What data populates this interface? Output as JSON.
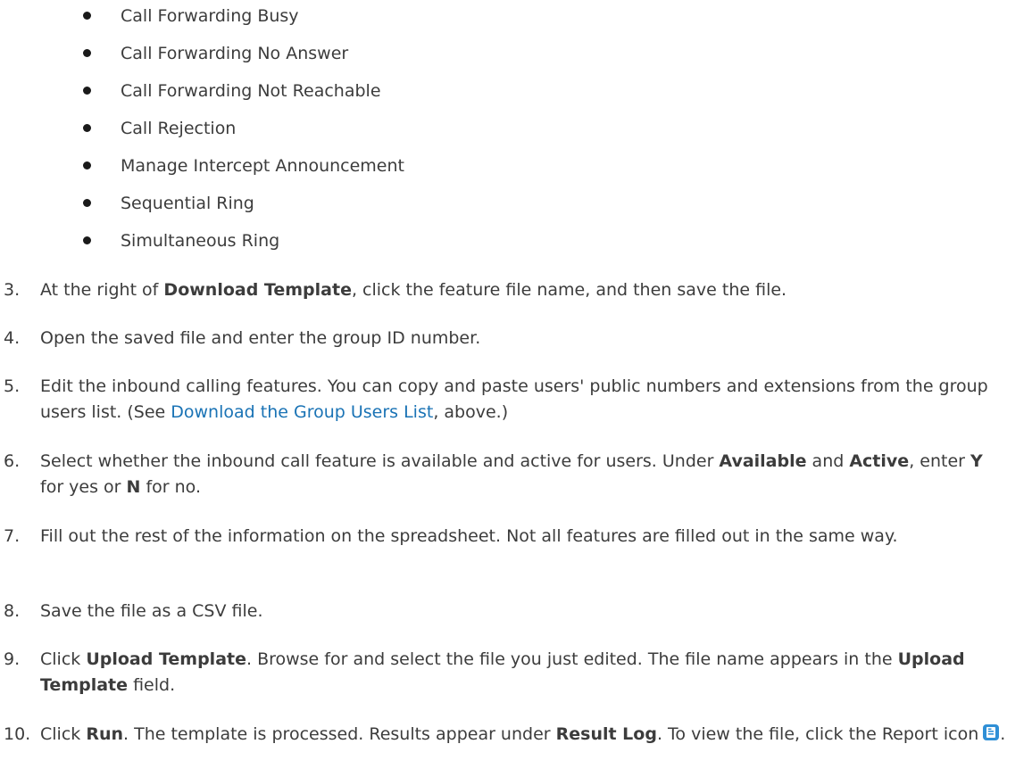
{
  "bullets": [
    "Call Forwarding Busy",
    "Call Forwarding No Answer",
    "Call Forwarding Not Reachable",
    "Call Rejection",
    "Manage Intercept Announcement",
    "Sequential Ring",
    "Simultaneous Ring"
  ],
  "steps": [
    {
      "num": "3.",
      "t1": "At the right of ",
      "b1": "Download Template",
      "t2": ", click the feature file name, and then save the file."
    },
    {
      "num": "4.",
      "t1": "Open the saved file and enter the group ID number."
    },
    {
      "num": "5.",
      "t1": "Edit the inbound calling features. You can copy and paste users' public numbers and extensions from the group users list. (See ",
      "link": "Download the Group Users List",
      "t2": ", above.)"
    },
    {
      "num": "6.",
      "t1": "Select whether the inbound call feature is available and active for users. Under ",
      "b1": "Available",
      "t2": " and ",
      "b2": "Active",
      "t3": ", enter ",
      "b3": "Y",
      "t4": " for yes or ",
      "b4": "N",
      "t5": " for no."
    },
    {
      "num": "7.",
      "t1": "Fill out the rest of the information on the spreadsheet. Not all features are filled out in the same way."
    },
    {
      "num": "8.",
      "t1": "Save the file as a CSV file."
    },
    {
      "num": "9.",
      "t1": "Click ",
      "b1": "Upload Template",
      "t2": ". Browse for and select the file you just edited. The file name appears in the ",
      "b2": "Upload Template",
      "t3": " field."
    },
    {
      "num": "10.",
      "t1": "Click ",
      "b1": "Run",
      "t2": ". The template is processed. Results appear under ",
      "b2": "Result Log",
      "t3": ". To view the file, click the Report icon",
      "t4": "."
    }
  ],
  "colors": {
    "text": "#3c3c3c",
    "link": "#1a73b5",
    "icon": "#2f8fd6"
  },
  "icons": {
    "report": "report-icon"
  }
}
